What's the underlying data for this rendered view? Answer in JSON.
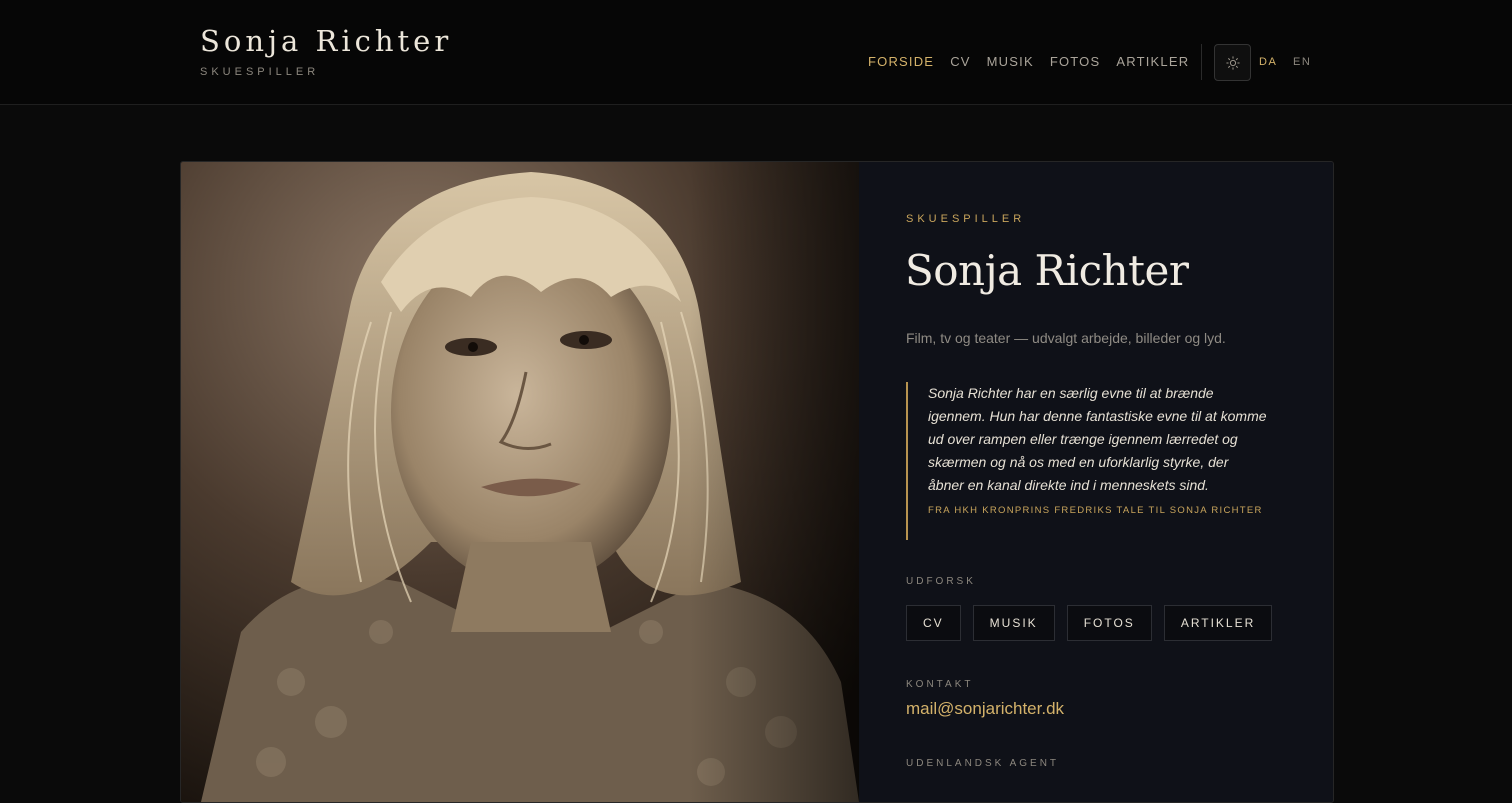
{
  "header": {
    "name": "Sonja Richter",
    "role": "SKUESPILLER",
    "nav": [
      {
        "label": "FORSIDE",
        "active": true
      },
      {
        "label": "CV",
        "active": false
      },
      {
        "label": "MUSIK",
        "active": false
      },
      {
        "label": "FOTOS",
        "active": false
      },
      {
        "label": "ARTIKLER",
        "active": false
      }
    ],
    "theme_icon": "sun-icon",
    "languages": [
      "DA",
      "EN"
    ],
    "active_language": "DA"
  },
  "hero": {
    "eyebrow": "SKUESPILLER",
    "title": "Sonja Richter",
    "subtitle": "Film, tv og teater — udvalgt arbejde, billeder og lyd.",
    "quote": "Sonja Richter har en særlig evne til at brænde igennem. Hun har denne fantastiske evne til at komme ud over rampen eller trænge igennem lærredet og skærmen og nå os med en uforklarlig styrke, der åbner en kanal direkte ind i menneskets sind.",
    "quote_source": "FRA HKH KRONPRINS FREDRIKS TALE TIL SONJA RICHTER",
    "explore_label": "UDFORSK",
    "explore_links": [
      "CV",
      "MUSIK",
      "FOTOS",
      "ARTIKLER"
    ],
    "contact_label": "KONTAKT",
    "email": "mail@sonjarichter.dk",
    "agent_label": "UDENLANDSK AGENT"
  },
  "colors": {
    "accent": "#d4b26a",
    "background": "#0a0a0a",
    "panel": "#0f1118"
  }
}
